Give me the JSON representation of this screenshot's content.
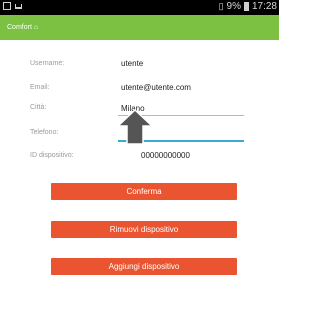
{
  "status_bar": {
    "battery_percent": "9%",
    "time": "17:28"
  },
  "app_bar": {
    "brand": "Comfort"
  },
  "form": {
    "username_label": "Username:",
    "username_value": "utente",
    "email_label": "Email:",
    "email_value": "utente@utente.com",
    "city_label": "Città:",
    "city_value": "Milano",
    "phone_label": "Telefono:",
    "phone_value": "",
    "device_id_label": "ID dispositivo:",
    "device_id_value": "00000000000"
  },
  "buttons": {
    "confirm": "Conferma",
    "remove_device": "Rimuovi dispositivo",
    "add_device": "Aggiungi dispositivo"
  },
  "colors": {
    "appbar": "#7cc142",
    "button": "#ea5430",
    "focus_line": "#39a9d6"
  },
  "icons": [
    "image-icon",
    "notification-icon",
    "signal-icon",
    "battery-icon",
    "brand-logo-icon",
    "up-arrow-icon"
  ]
}
